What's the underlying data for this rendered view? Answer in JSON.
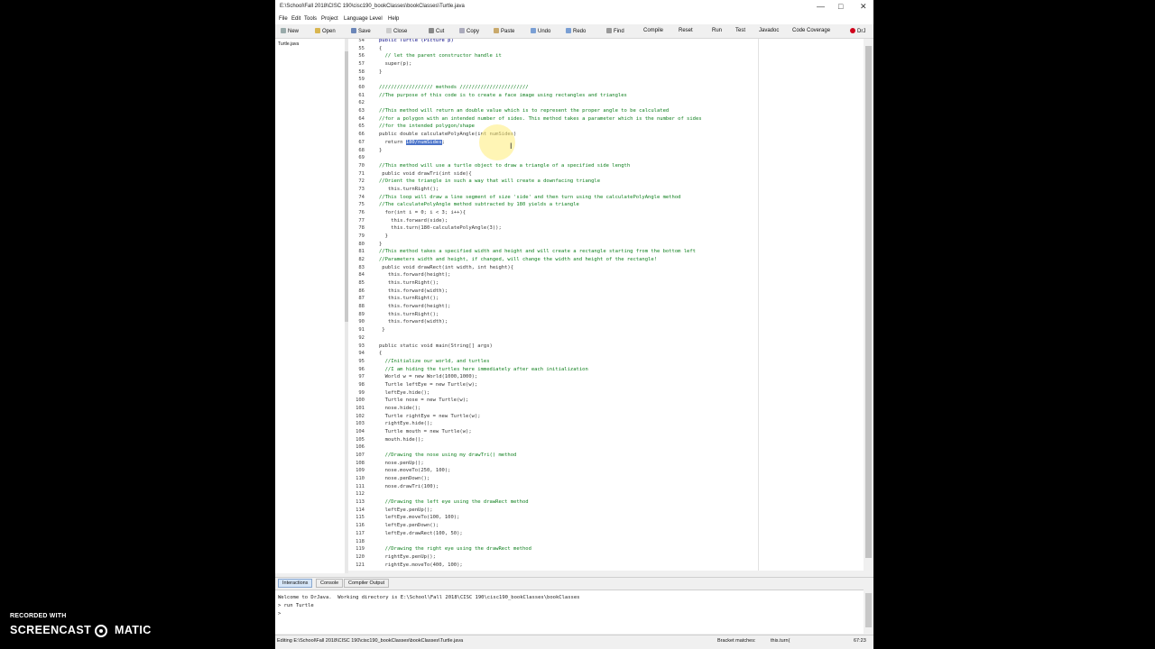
{
  "window": {
    "title": "E:\\School\\Fall 2018\\CISC 190\\cisc190_bookClasses\\bookClasses\\Turtle.java",
    "minimize": "—",
    "maximize": "□",
    "close": "✕"
  },
  "menu": [
    "File",
    "Edit",
    "Tools",
    "Project",
    "Language Level",
    "Help"
  ],
  "toolbar": {
    "new": "New",
    "open": "Open",
    "save": "Save",
    "close": "Close",
    "cut": "Cut",
    "copy": "Copy",
    "paste": "Paste",
    "undo": "Undo",
    "redo": "Redo",
    "find": "Find",
    "compile": "Compile",
    "reset": "Reset",
    "run": "Run",
    "test": "Test",
    "javadoc": "Javadoc",
    "coverage": "Code Coverage",
    "drjava": "DrJ"
  },
  "documents": [
    "Turtle.java"
  ],
  "colors": {
    "comment": "#0d7e1c",
    "selection": "#4a73c9",
    "close_icon": "#d0021b"
  },
  "code_lines": [
    {
      "n": "54",
      "t": "public Turtle (Picture p)",
      "c": "kw"
    },
    {
      "n": "55",
      "t": "{",
      "c": ""
    },
    {
      "n": "56",
      "t": "  // let the parent constructor handle it",
      "c": "cm"
    },
    {
      "n": "57",
      "t": "  super(p);",
      "c": ""
    },
    {
      "n": "58",
      "t": "}",
      "c": ""
    },
    {
      "n": "59",
      "t": "",
      "c": ""
    },
    {
      "n": "60",
      "t": "////////////////// methods ///////////////////////",
      "c": "cm"
    },
    {
      "n": "61",
      "t": "//The purpose of this code is to create a face image using rectangles and triangles",
      "c": "cm"
    },
    {
      "n": "62",
      "t": "",
      "c": ""
    },
    {
      "n": "63",
      "t": "//This method will return an double value which is to represent the proper angle to be calculated",
      "c": "cm"
    },
    {
      "n": "64",
      "t": "//for a polygon with an intended number of sides. This method takes a parameter which is the number of sides",
      "c": "cm"
    },
    {
      "n": "65",
      "t": "//for the intended polygon/shape",
      "c": "cm"
    },
    {
      "n": "66",
      "t": "public double calculatePolyAngle(int numSides)",
      "c": ""
    },
    {
      "n": "67",
      "t": "  return ",
      "c": "",
      "sel": "180/numSides",
      "after": ";"
    },
    {
      "n": "68",
      "t": "}",
      "c": ""
    },
    {
      "n": "69",
      "t": "",
      "c": ""
    },
    {
      "n": "70",
      "t": "//This method will use a turtle object to draw a triangle of a specified side length",
      "c": "cm"
    },
    {
      "n": "71",
      "t": " public void drawTri(int side){",
      "c": ""
    },
    {
      "n": "72",
      "t": "//Orient the triangle in such a way that will create a downfacing triangle",
      "c": "cm"
    },
    {
      "n": "73",
      "t": "   this.turnRight();",
      "c": ""
    },
    {
      "n": "74",
      "t": "//This loop will draw a line segment of size 'side' and then turn using the calculatePolyAngle method",
      "c": "cm"
    },
    {
      "n": "75",
      "t": "//The calculatePolyAngle method subtracted by 180 yields a triangle",
      "c": "cm"
    },
    {
      "n": "76",
      "t": "  for(int i = 0; i < 3; i++){",
      "c": ""
    },
    {
      "n": "77",
      "t": "    this.forward(side);",
      "c": ""
    },
    {
      "n": "78",
      "t": "    this.turn(180-calculatePolyAngle(3));",
      "c": ""
    },
    {
      "n": "79",
      "t": "  }",
      "c": ""
    },
    {
      "n": "80",
      "t": "}",
      "c": ""
    },
    {
      "n": "81",
      "t": "//This method takes a specified width and height and will create a rectangle starting from the bottom left",
      "c": "cm"
    },
    {
      "n": "82",
      "t": "//Parameters width and height, if changed, will change the width and height of the rectangle!",
      "c": "cm"
    },
    {
      "n": "83",
      "t": " public void drawRect(int width, int height){",
      "c": ""
    },
    {
      "n": "84",
      "t": "   this.forward(height);",
      "c": ""
    },
    {
      "n": "85",
      "t": "   this.turnRight();",
      "c": ""
    },
    {
      "n": "86",
      "t": "   this.forward(width);",
      "c": ""
    },
    {
      "n": "87",
      "t": "   this.turnRight();",
      "c": ""
    },
    {
      "n": "88",
      "t": "   this.forward(height);",
      "c": ""
    },
    {
      "n": "89",
      "t": "   this.turnRight();",
      "c": ""
    },
    {
      "n": "90",
      "t": "   this.forward(width);",
      "c": ""
    },
    {
      "n": "91",
      "t": " }",
      "c": ""
    },
    {
      "n": "92",
      "t": "",
      "c": ""
    },
    {
      "n": "93",
      "t": "public static void main(String[] args)",
      "c": ""
    },
    {
      "n": "94",
      "t": "{",
      "c": ""
    },
    {
      "n": "95",
      "t": "  //Initialize our world, and turtles",
      "c": "cm"
    },
    {
      "n": "96",
      "t": "  //I am hiding the turtles here immediately after each initialization",
      "c": "cm"
    },
    {
      "n": "97",
      "t": "  World w = new World(1000,1000);",
      "c": ""
    },
    {
      "n": "98",
      "t": "  Turtle leftEye = new Turtle(w);",
      "c": ""
    },
    {
      "n": "99",
      "t": "  leftEye.hide();",
      "c": ""
    },
    {
      "n": "100",
      "t": "  Turtle nose = new Turtle(w);",
      "c": ""
    },
    {
      "n": "101",
      "t": "  nose.hide();",
      "c": ""
    },
    {
      "n": "102",
      "t": "  Turtle rightEye = new Turtle(w);",
      "c": ""
    },
    {
      "n": "103",
      "t": "  rightEye.hide();",
      "c": ""
    },
    {
      "n": "104",
      "t": "  Turtle mouth = new Turtle(w);",
      "c": ""
    },
    {
      "n": "105",
      "t": "  mouth.hide();",
      "c": ""
    },
    {
      "n": "106",
      "t": "",
      "c": ""
    },
    {
      "n": "107",
      "t": "  //Drawing the nose using my drawTri() method",
      "c": "cm"
    },
    {
      "n": "108",
      "t": "  nose.penUp();",
      "c": ""
    },
    {
      "n": "109",
      "t": "  nose.moveTo(250, 100);",
      "c": ""
    },
    {
      "n": "110",
      "t": "  nose.penDown();",
      "c": ""
    },
    {
      "n": "111",
      "t": "  nose.drawTri(100);",
      "c": ""
    },
    {
      "n": "112",
      "t": "",
      "c": ""
    },
    {
      "n": "113",
      "t": "  //Drawing the left eye using the drawRect method",
      "c": "cm"
    },
    {
      "n": "114",
      "t": "  leftEye.penUp();",
      "c": ""
    },
    {
      "n": "115",
      "t": "  leftEye.moveTo(100, 100);",
      "c": ""
    },
    {
      "n": "116",
      "t": "  leftEye.penDown();",
      "c": ""
    },
    {
      "n": "117",
      "t": "  leftEye.drawRect(100, 50);",
      "c": ""
    },
    {
      "n": "118",
      "t": "",
      "c": ""
    },
    {
      "n": "119",
      "t": "  //Drawing the right eye using the drawRect method",
      "c": "cm"
    },
    {
      "n": "120",
      "t": "  rightEye.penUp();",
      "c": ""
    },
    {
      "n": "121",
      "t": "  rightEye.moveTo(400, 100);",
      "c": ""
    }
  ],
  "bottom_tabs": [
    "Interactions",
    "Console",
    "Compiler Output"
  ],
  "interactions": [
    "Welcome to DrJava.  Working directory is E:\\School\\Fall 2018\\CISC 190\\cisc190_bookClasses\\bookClasses",
    "> run Turtle",
    ">"
  ],
  "status": {
    "editing": "Editing E:\\School\\Fall 2018\\CISC 190\\cisc190_bookClasses\\bookClasses\\Turtle.java",
    "bracket_label": "Bracket matches:",
    "bracket_value": "this.turn(",
    "position": "67:23"
  },
  "watermark": {
    "line1": "RECORDED WITH",
    "brand_left": "SCREENCAST",
    "brand_right": "MATIC"
  }
}
